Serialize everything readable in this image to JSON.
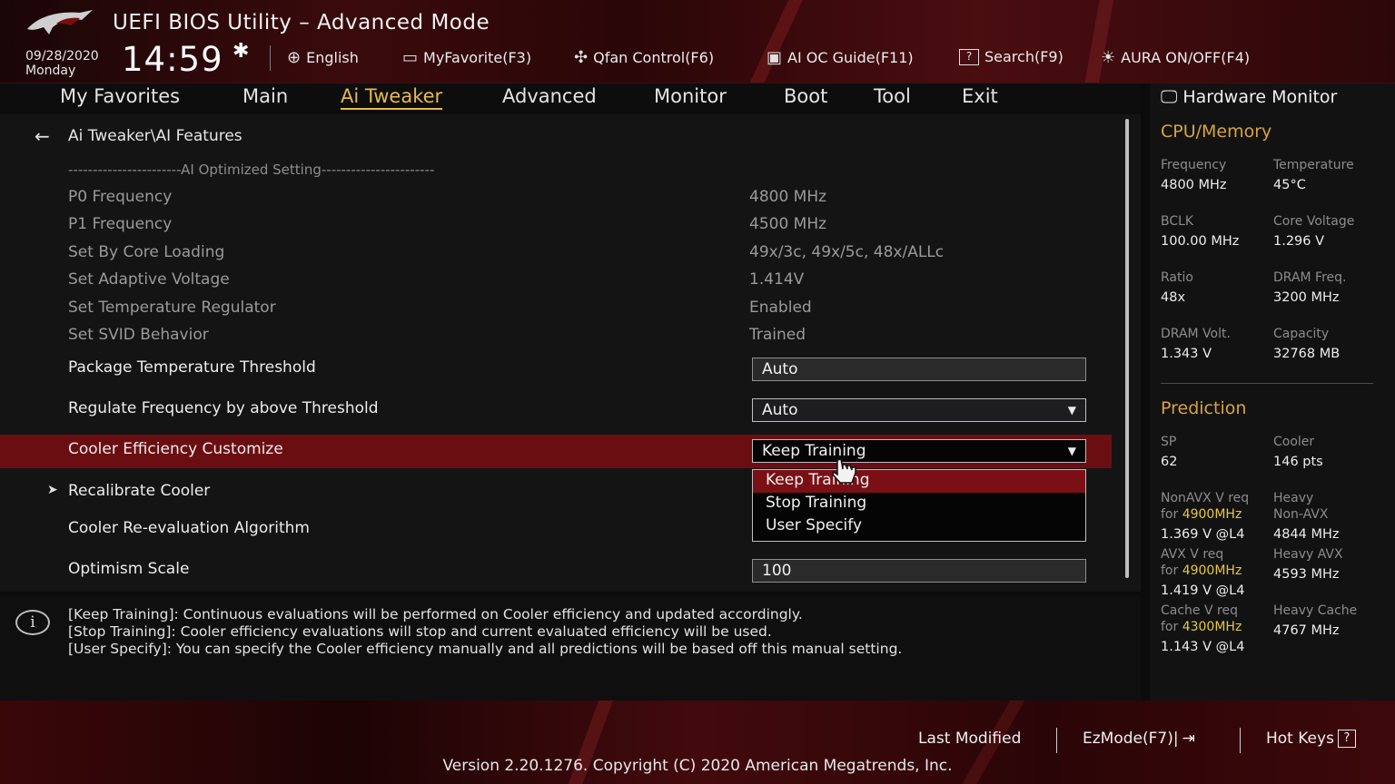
{
  "header": {
    "title": "UEFI BIOS Utility – Advanced Mode",
    "date": "09/28/2020",
    "day": "Monday",
    "time": "14:59",
    "items": [
      {
        "label": "English",
        "icon": "globe-icon"
      },
      {
        "label": "MyFavorite(F3)",
        "icon": "favorite-icon"
      },
      {
        "label": "Qfan Control(F6)",
        "icon": "fan-icon"
      },
      {
        "label": "AI OC Guide(F11)",
        "icon": "ai-chip-icon"
      },
      {
        "label": "Search(F9)",
        "icon": "search-help-icon"
      },
      {
        "label": "AURA ON/OFF(F4)",
        "icon": "aura-light-icon"
      }
    ]
  },
  "nav": {
    "tabs": [
      "My Favorites",
      "Main",
      "Ai Tweaker",
      "Advanced",
      "Monitor",
      "Boot",
      "Tool",
      "Exit"
    ],
    "active": "Ai Tweaker"
  },
  "main": {
    "breadcrumb": "Ai Tweaker\\AI Features",
    "section_heading": "-----------------------AI Optimized Setting-----------------------",
    "readonly_rows": [
      {
        "label": "P0 Frequency",
        "value": "4800 MHz"
      },
      {
        "label": "P1 Frequency",
        "value": "4500 MHz"
      },
      {
        "label": "Set By Core Loading",
        "value": "49x/3c, 49x/5c, 48x/ALLc"
      },
      {
        "label": "Set Adaptive Voltage",
        "value": "1.414V"
      },
      {
        "label": "Set Temperature Regulator",
        "value": "Enabled"
      },
      {
        "label": "Set SVID Behavior",
        "value": "Trained"
      }
    ],
    "settings": {
      "package_temp": {
        "label": "Package Temperature Threshold",
        "value": "Auto"
      },
      "regulate_freq": {
        "label": "Regulate Frequency by above Threshold",
        "value": "Auto"
      },
      "cooler_eff": {
        "label": "Cooler Efficiency Customize",
        "value": "Keep Training"
      },
      "recalibrate": {
        "label": "Recalibrate Cooler"
      },
      "reeval": {
        "label": "Cooler Re-evaluation Algorithm"
      },
      "optimism": {
        "label": "Optimism Scale",
        "value": "100"
      }
    },
    "dropdown_options": [
      "Keep Training",
      "Stop Training",
      "User Specify"
    ],
    "dropdown_selected": "Keep Training"
  },
  "help": {
    "lines": [
      "[Keep Training]: Continuous evaluations will be performed on Cooler efficiency and updated accordingly.",
      "[Stop Training]: Cooler efficiency evaluations will stop and current evaluated efficiency will be used.",
      "[User Specify]: You can specify the Cooler efficiency manually and all predictions will be based off this manual setting."
    ]
  },
  "hw_monitor": {
    "title": "Hardware Monitor",
    "cpu_memory": {
      "heading": "CPU/Memory",
      "frequency": {
        "label": "Frequency",
        "value": "4800 MHz"
      },
      "temperature": {
        "label": "Temperature",
        "value": "45°C"
      },
      "bclk": {
        "label": "BCLK",
        "value": "100.00 MHz"
      },
      "core_voltage": {
        "label": "Core Voltage",
        "value": "1.296 V"
      },
      "ratio": {
        "label": "Ratio",
        "value": "48x"
      },
      "dram_freq": {
        "label": "DRAM Freq.",
        "value": "3200 MHz"
      },
      "dram_volt": {
        "label": "DRAM Volt.",
        "value": "1.343 V"
      },
      "capacity": {
        "label": "Capacity",
        "value": "32768 MB"
      }
    },
    "prediction": {
      "heading": "Prediction",
      "sp": {
        "label": "SP",
        "value": "62"
      },
      "cooler": {
        "label": "Cooler",
        "value": "146 pts"
      },
      "nonavx": {
        "label": "NonAVX V req",
        "for": "for",
        "freq": "4900MHz",
        "value": "1.369 V @L4"
      },
      "heavy_nonavx": {
        "label1": "Heavy",
        "label2": "Non-AVX",
        "value": "4844 MHz"
      },
      "avx": {
        "label": "AVX V req",
        "for": "for",
        "freq": "4900MHz",
        "value": "1.419 V @L4"
      },
      "heavy_avx": {
        "label": "Heavy AVX",
        "value": "4593 MHz"
      },
      "cache": {
        "label": "Cache V req",
        "for": "for",
        "freq": "4300MHz",
        "value": "1.143 V @L4"
      },
      "heavy_cache": {
        "label": "Heavy Cache",
        "value": "4767 MHz"
      }
    }
  },
  "footer": {
    "last_modified": "Last Modified",
    "ezmode": "EzMode(F7)|",
    "hotkeys": "Hot Keys",
    "version": "Version 2.20.1276. Copyright (C) 2020 American Megatrends, Inc."
  },
  "colors": {
    "accent": "#e9b949",
    "highlight_row": "#6b0e12",
    "hw_heading": "#d9a43c",
    "hw_freq_highlight": "#e7c93a"
  }
}
